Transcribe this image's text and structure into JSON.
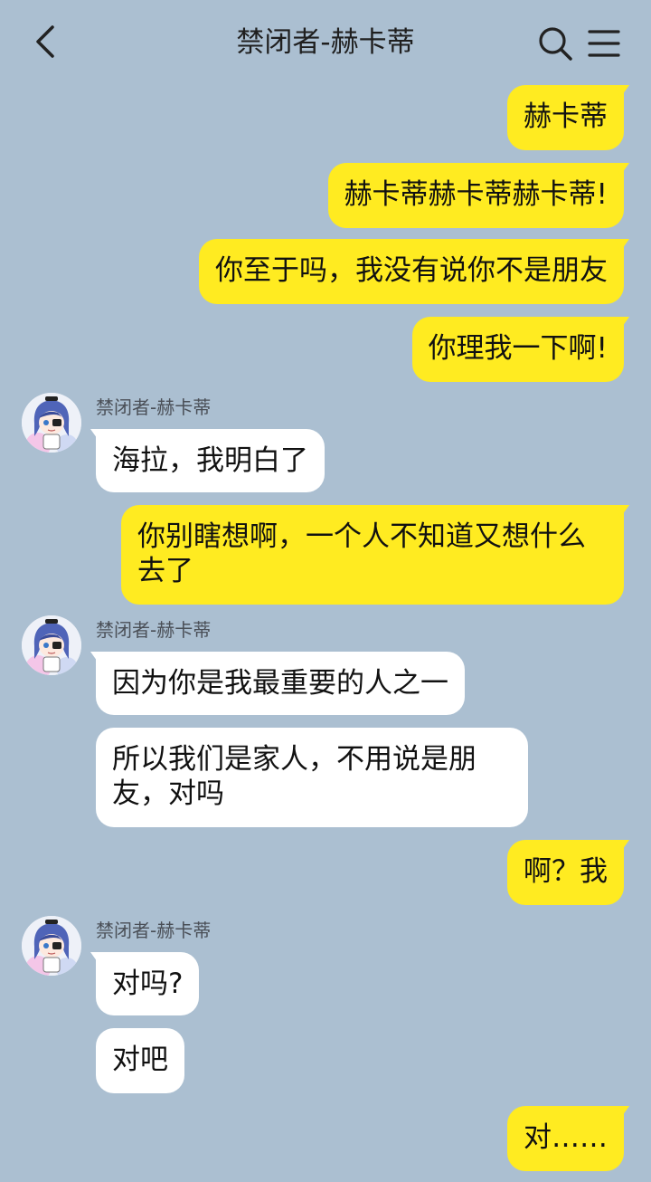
{
  "header": {
    "title": "禁闭者-赫卡蒂",
    "back_icon": "chevron-left-icon",
    "search_icon": "search-icon",
    "menu_icon": "hamburger-menu-icon"
  },
  "colors": {
    "background": "#abbfd1",
    "outgoing_bubble": "#ffeb21",
    "incoming_bubble": "#ffffff"
  },
  "messages": [
    {
      "side": "right",
      "text": "赫卡蒂"
    },
    {
      "side": "right",
      "text": "赫卡蒂赫卡蒂赫卡蒂!"
    },
    {
      "side": "right",
      "text": "你至于吗，我没有说你不是朋友"
    },
    {
      "side": "right",
      "text": "你理我一下啊!"
    },
    {
      "side": "left",
      "sender": "禁闭者-赫卡蒂",
      "text": "海拉，我明白了"
    },
    {
      "side": "right",
      "text": "你别瞎想啊，一个人不知道又想什么去了"
    },
    {
      "side": "left",
      "sender": "禁闭者-赫卡蒂",
      "text": "因为你是我最重要的人之一"
    },
    {
      "side": "left",
      "text": "所以我们是家人，不用说是朋友，对吗"
    },
    {
      "side": "right",
      "text": "啊？我"
    },
    {
      "side": "left",
      "sender": "禁闭者-赫卡蒂",
      "text": "对吗?"
    },
    {
      "side": "left",
      "text": "对吧"
    },
    {
      "side": "right",
      "text": "对……"
    }
  ]
}
